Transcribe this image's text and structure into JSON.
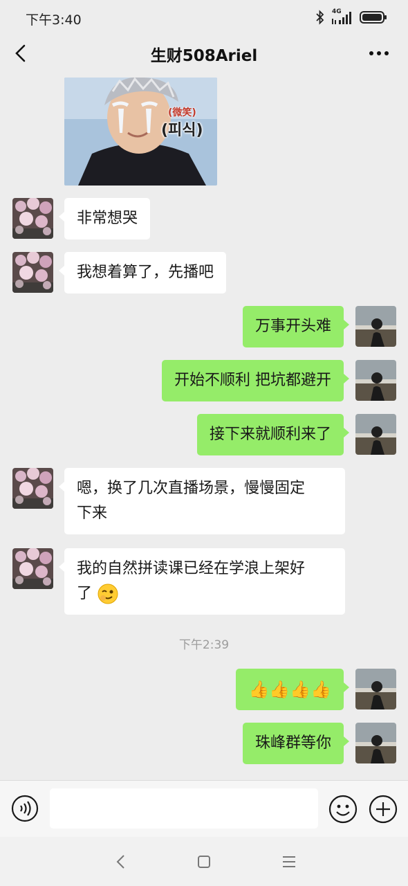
{
  "status_bar": {
    "time": "下午3:40",
    "network": "4G"
  },
  "header": {
    "title": "生财508Ariel"
  },
  "sticker": {
    "caption_top": "(微笑)",
    "caption_bottom": "(피식)"
  },
  "messages": [
    {
      "side": "in",
      "text": "非常想哭"
    },
    {
      "side": "in",
      "text": "我想着算了，先播吧"
    },
    {
      "side": "out",
      "text": "万事开头难"
    },
    {
      "side": "out",
      "text": "开始不顺利 把坑都避开"
    },
    {
      "side": "out",
      "text": "接下来就顺利来了"
    },
    {
      "side": "in",
      "text_line1": "嗯，换了几次直播场景，慢慢固定",
      "text_line2": "下来"
    },
    {
      "side": "in",
      "text_line1": "我的自然拼读课已经在学浪上架好",
      "text_line2": "了"
    },
    {
      "side": "out",
      "text": "👍👍👍👍"
    },
    {
      "side": "out",
      "text": "珠峰群等你"
    }
  ],
  "timestamp": "下午2:39",
  "input": {
    "value": "",
    "placeholder": ""
  },
  "colors": {
    "background": "#ededed",
    "out_bubble": "#95ec69",
    "in_bubble": "#ffffff"
  },
  "icons": {
    "back": "chevron-left-icon",
    "more": "more-dots-icon",
    "voice": "voice-icon",
    "emoji": "emoji-icon",
    "plus": "plus-icon"
  }
}
